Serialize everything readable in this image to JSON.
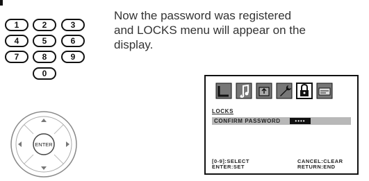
{
  "instruction": {
    "line1": "Now the password was registered",
    "line2": "and LOCKS menu will appear on the",
    "line3": "display."
  },
  "keypad": {
    "keys": [
      "1",
      "2",
      "3",
      "4",
      "5",
      "6",
      "7",
      "8",
      "9",
      "0"
    ]
  },
  "dpad": {
    "center_label": "ENTER"
  },
  "osd": {
    "tab_icons": [
      "disc-icon",
      "music-note-icon",
      "speaker-box-icon",
      "wrench-icon",
      "padlock-icon",
      "card-icon"
    ],
    "title": "LOCKS",
    "confirm_label": "CONFIRM PASSWORD",
    "password_mask": "••••",
    "hint_left_1": "[0-9]:SELECT",
    "hint_left_2": "ENTER:SET",
    "hint_right_1": "CANCEL:CLEAR",
    "hint_right_2": "RETURN:END"
  }
}
